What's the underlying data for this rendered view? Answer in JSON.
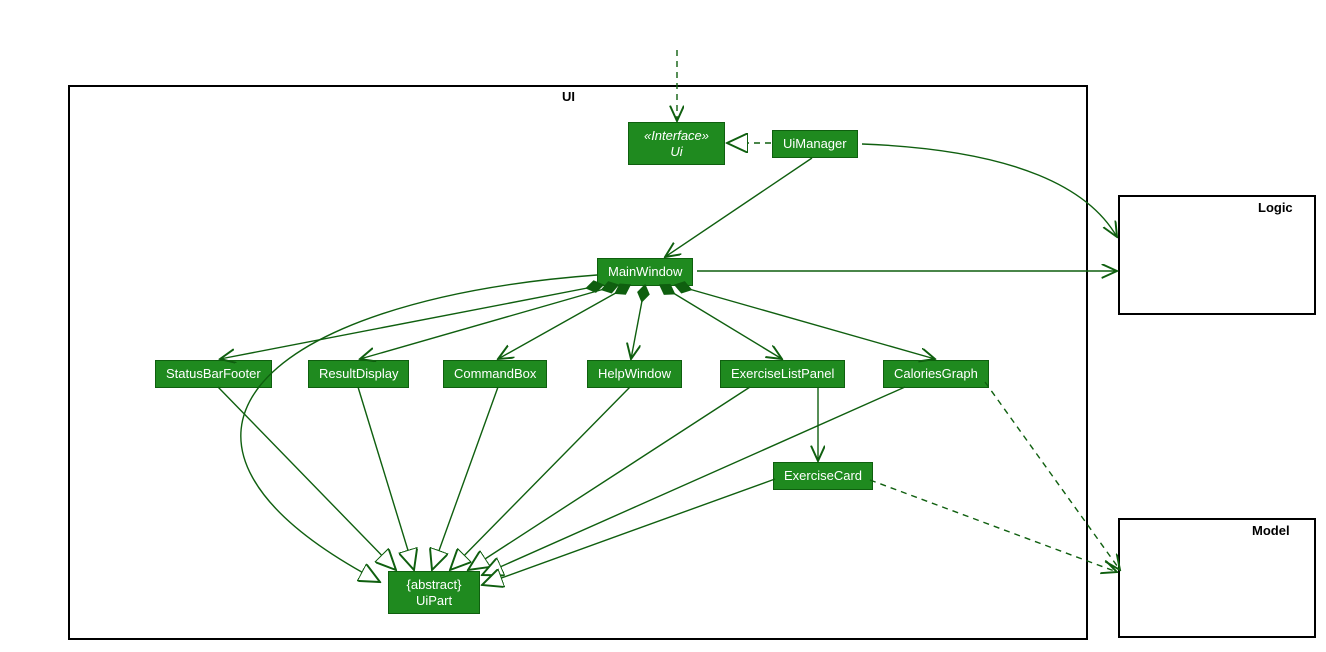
{
  "packages": {
    "ui": {
      "label": "UI"
    },
    "logic": {
      "label": "Logic"
    },
    "model": {
      "label": "Model"
    }
  },
  "nodes": {
    "ui_iface": {
      "stereotype": "«Interface»",
      "name": "Ui"
    },
    "ui_manager": {
      "name": "UiManager"
    },
    "main_window": {
      "name": "MainWindow"
    },
    "status_bar": {
      "name": "StatusBarFooter"
    },
    "result_display": {
      "name": "ResultDisplay"
    },
    "command_box": {
      "name": "CommandBox"
    },
    "help_window": {
      "name": "HelpWindow"
    },
    "exercise_list": {
      "name": "ExerciseListPanel"
    },
    "calories_graph": {
      "name": "CaloriesGraph"
    },
    "exercise_card": {
      "name": "ExerciseCard"
    },
    "ui_part": {
      "modifier": "{abstract}",
      "name": "UiPart"
    }
  },
  "colors": {
    "node_bg": "#1f8a1f",
    "edge": "#0f5f0f"
  }
}
